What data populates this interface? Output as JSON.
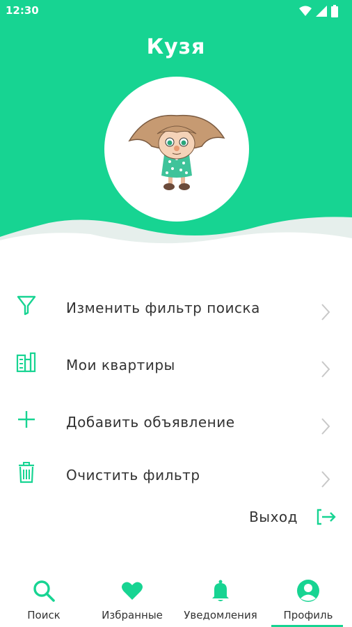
{
  "status_bar": {
    "time": "12:30"
  },
  "profile": {
    "name": "Кузя"
  },
  "menu": {
    "items": [
      {
        "label": "Изменить фильтр поиска",
        "icon": "filter-icon"
      },
      {
        "label": "Мои квартиры",
        "icon": "buildings-icon"
      },
      {
        "label": "Добавить объявление",
        "icon": "plus-icon"
      },
      {
        "label": "Очистить фильтр",
        "icon": "trash-icon"
      }
    ]
  },
  "logout": {
    "label": "Выход",
    "icon": "logout-icon"
  },
  "bottom_nav": {
    "items": [
      {
        "label": "Поиск",
        "icon": "search-icon"
      },
      {
        "label": "Избранные",
        "icon": "heart-icon"
      },
      {
        "label": "Уведомления",
        "icon": "bell-icon"
      },
      {
        "label": "Профиль",
        "icon": "profile-icon"
      }
    ],
    "active": "Профиль"
  },
  "colors": {
    "accent": "#17d492",
    "text": "#333333",
    "wave_light": "#e8f1ee"
  }
}
